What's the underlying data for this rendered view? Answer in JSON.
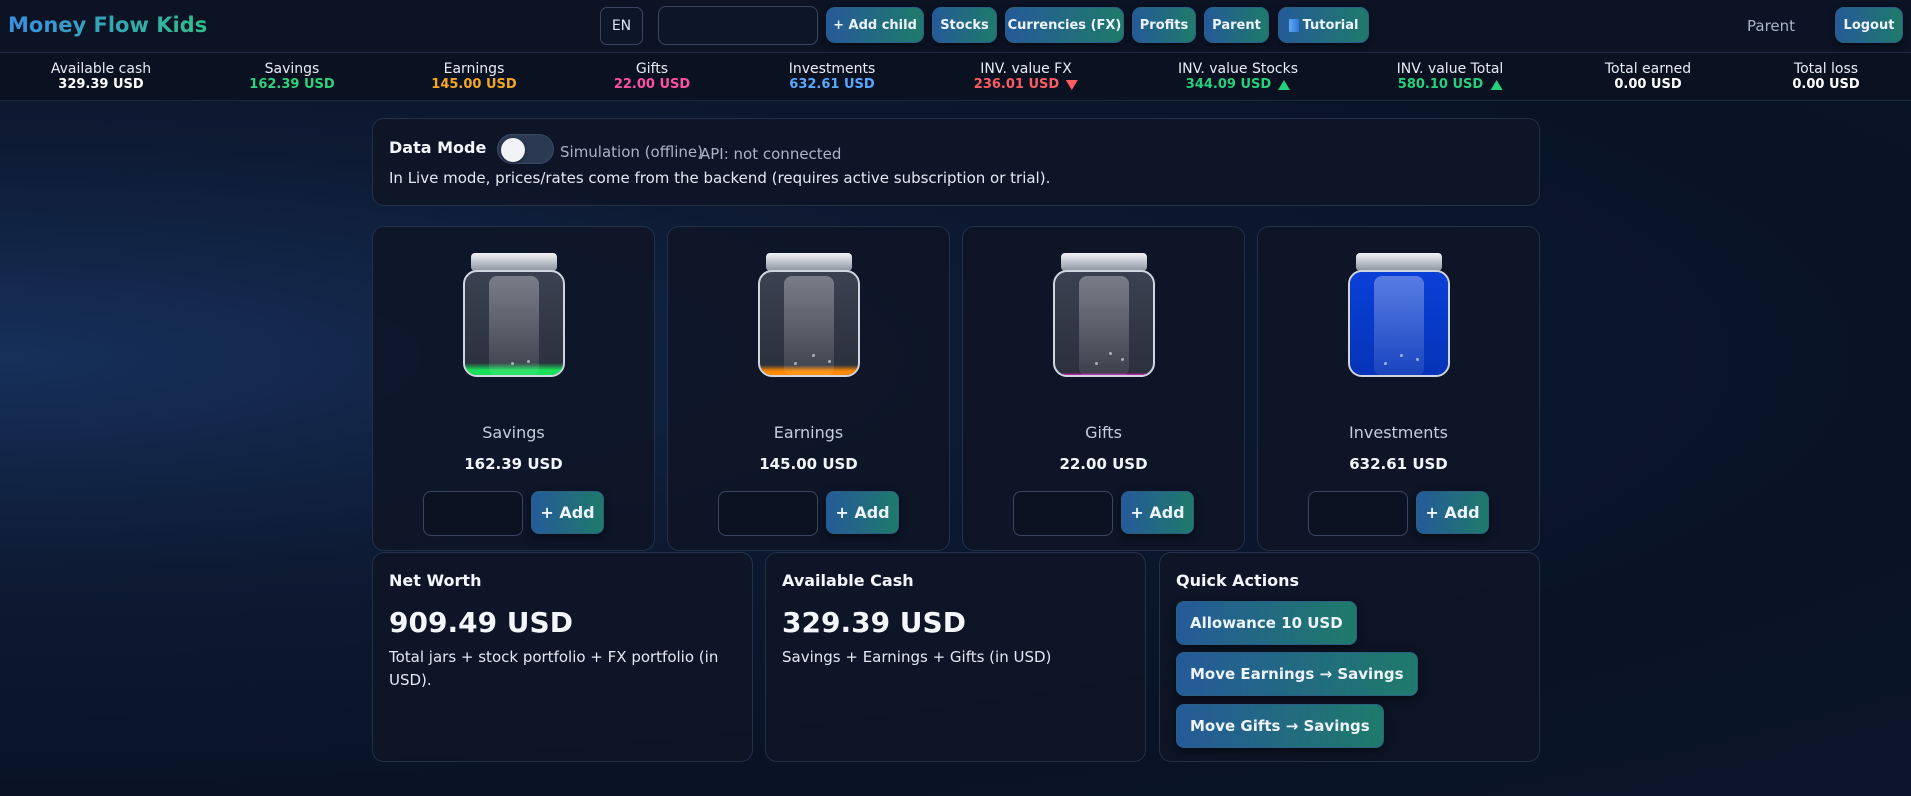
{
  "header": {
    "brand": "Money Flow Kids",
    "language": "EN",
    "search_value": "",
    "nav": {
      "add_child": "+ Add child",
      "stocks": "Stocks",
      "currencies": "Currencies (FX)",
      "profits": "Profits",
      "parent": "Parent",
      "tutorial": "Tutorial"
    },
    "role_label": "Parent",
    "logout": "Logout"
  },
  "stats": [
    {
      "label": "Available cash",
      "value": "329.39 USD",
      "color": "#ffffff",
      "trend": ""
    },
    {
      "label": "Savings",
      "value": "162.39 USD",
      "color": "#2fd27a",
      "trend": ""
    },
    {
      "label": "Earnings",
      "value": "145.00 USD",
      "color": "#f5a623",
      "trend": ""
    },
    {
      "label": "Gifts",
      "value": "22.00 USD",
      "color": "#ff4fa3",
      "trend": ""
    },
    {
      "label": "Investments",
      "value": "632.61 USD",
      "color": "#5aa7ff",
      "trend": ""
    },
    {
      "label": "INV. value FX",
      "value": "236.01 USD",
      "color": "#ff5b63",
      "trend": "down"
    },
    {
      "label": "INV. value Stocks",
      "value": "344.09 USD",
      "color": "#26d07c",
      "trend": "up"
    },
    {
      "label": "INV. value Total",
      "value": "580.10 USD",
      "color": "#26d07c",
      "trend": "up"
    },
    {
      "label": "Total earned",
      "value": "0.00 USD",
      "color": "#ffffff",
      "trend": ""
    },
    {
      "label": "Total loss",
      "value": "0.00 USD",
      "color": "#ffffff",
      "trend": ""
    }
  ],
  "data_mode": {
    "title": "Data Mode",
    "toggle_state": "off",
    "simulation_label": "Simulation (offline)",
    "api_status": "API: not connected",
    "description": "In Live mode, prices/rates come from the backend (requires active subscription or trial)."
  },
  "jars": [
    {
      "label": "Savings",
      "amount": "162.39 USD",
      "fill_color": "#19e15a",
      "fill_level": 0.12,
      "add_label": "+ Add"
    },
    {
      "label": "Earnings",
      "amount": "145.00 USD",
      "fill_color": "#ff8a00",
      "fill_level": 0.1,
      "add_label": "+ Add"
    },
    {
      "label": "Gifts",
      "amount": "22.00 USD",
      "fill_color": "#b02aa4",
      "fill_level": 0.02,
      "add_label": "+ Add"
    },
    {
      "label": "Investments",
      "amount": "632.61 USD",
      "fill_color": "#0a3fd8",
      "fill_level": 1.0,
      "add_label": "+ Add"
    }
  ],
  "net_worth": {
    "title": "Net Worth",
    "value": "909.49 USD",
    "description": "Total jars + stock portfolio + FX portfolio (in USD)."
  },
  "available_cash": {
    "title": "Available Cash",
    "value": "329.39 USD",
    "description": "Savings + Earnings + Gifts (in USD)"
  },
  "quick_actions": {
    "title": "Quick Actions",
    "items": [
      "Allowance 10 USD",
      "Move Earnings → Savings",
      "Move Gifts → Savings"
    ]
  }
}
